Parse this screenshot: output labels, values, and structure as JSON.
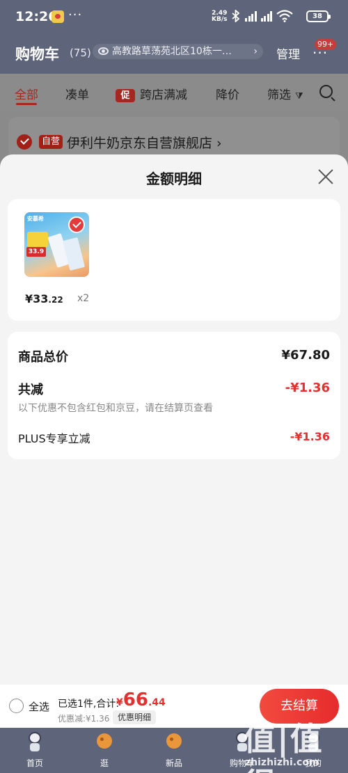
{
  "status_bar": {
    "time": "12:26",
    "net_speed_value": "2.49",
    "net_speed_unit": "KB/s",
    "battery": "38",
    "icons": [
      "weibo-icon",
      "more-dots-icon",
      "bluetooth-icon",
      "signal-icon",
      "signal-icon",
      "wifi-icon",
      "battery-icon"
    ]
  },
  "header": {
    "title": "购物车",
    "count": "(75)",
    "address": "高教路草荡苑北区10栋一…",
    "manage": "管理",
    "badge": "99+"
  },
  "tabs": [
    {
      "label": "全部",
      "active": true
    },
    {
      "label": "凑单"
    },
    {
      "label": "跨店满减",
      "chip": "促"
    },
    {
      "label": "降价"
    },
    {
      "label": "筛选"
    }
  ],
  "store": {
    "tag": "自营",
    "name": "伊利牛奶京东自营旗舰店 ›"
  },
  "sheet": {
    "title": "金额明细",
    "product": {
      "image_brand": "安慕希",
      "image_price": "33.9",
      "price_int": "¥33",
      "price_dec": ".22",
      "qty": "x2"
    },
    "summary": {
      "total_label": "商品总价",
      "total_value": "¥67.80",
      "reduce_label": "共减",
      "reduce_value": "-¥1.36",
      "hint": "以下优惠不包含红包和京豆，请在结算页查看",
      "plus_label": "PLUS专享立减",
      "plus_value": "-¥1.36"
    }
  },
  "checkout": {
    "select_all": "全选",
    "selected_text": "已选1件,合计:",
    "yen": "¥",
    "total_int": "66",
    "total_dec": ".44",
    "discount_text": "优惠减:¥1.36",
    "detail_button": "优惠明细",
    "checkout_button": "去结算"
  },
  "nav": [
    {
      "label": "首页"
    },
    {
      "label": "逛"
    },
    {
      "label": "新品"
    },
    {
      "label": "购物车"
    },
    {
      "label": "我的"
    }
  ],
  "watermark": {
    "big": "值|值得",
    "small": "zhizhizhi.com"
  },
  "colors": {
    "accent_red": "#e2312f",
    "overlay_header": "#5e6479",
    "sheet_bg": "#f4f4f4"
  }
}
